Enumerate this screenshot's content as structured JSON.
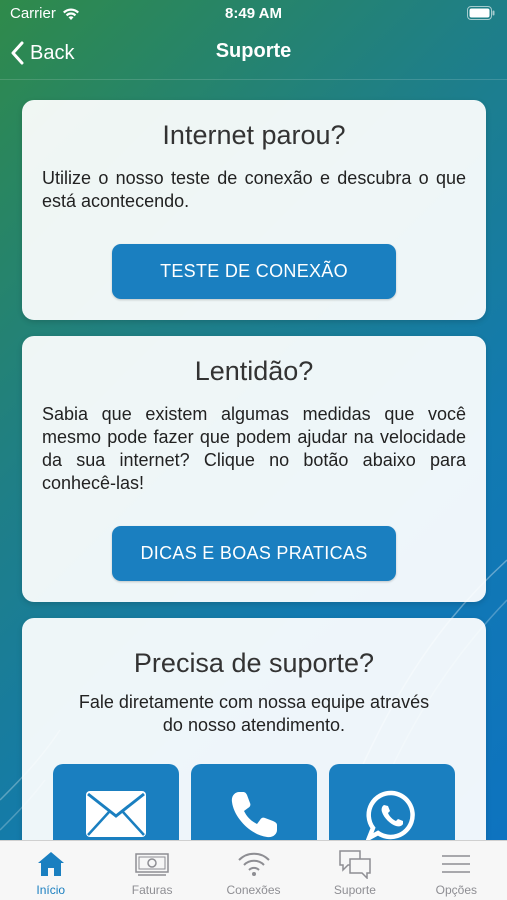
{
  "status": {
    "carrier": "Carrier",
    "time": "8:49 AM"
  },
  "nav": {
    "back_label": "Back",
    "title": "Suporte"
  },
  "cards": {
    "internet": {
      "title": "Internet parou?",
      "text": "Utilize o nosso teste de conexão e descubra o que está acontecendo.",
      "button": "TESTE DE CONEXÃO"
    },
    "lentidao": {
      "title": "Lentidão?",
      "text": "Sabia que existem algumas medidas que você mesmo pode fazer que podem ajudar na velocidade da sua internet? Clique no botão abaixo para conhecê-las!",
      "button": "DICAS E BOAS PRATICAS"
    },
    "suporte": {
      "title": "Precisa de suporte?",
      "text": "Fale diretamente com nossa equipe através do nosso atendimento.",
      "contacts": [
        "mail-icon",
        "phone-icon",
        "whatsapp-icon"
      ]
    }
  },
  "tabs": [
    {
      "label": "Início",
      "icon": "home-icon",
      "active": true
    },
    {
      "label": "Faturas",
      "icon": "cash-icon",
      "active": false
    },
    {
      "label": "Conexões",
      "icon": "wifi-icon",
      "active": false
    },
    {
      "label": "Suporte",
      "icon": "chat-icon",
      "active": false
    },
    {
      "label": "Opções",
      "icon": "menu-icon",
      "active": false
    }
  ],
  "colors": {
    "accent": "#1a7fc0",
    "inactive_tab": "#8e8e93"
  }
}
